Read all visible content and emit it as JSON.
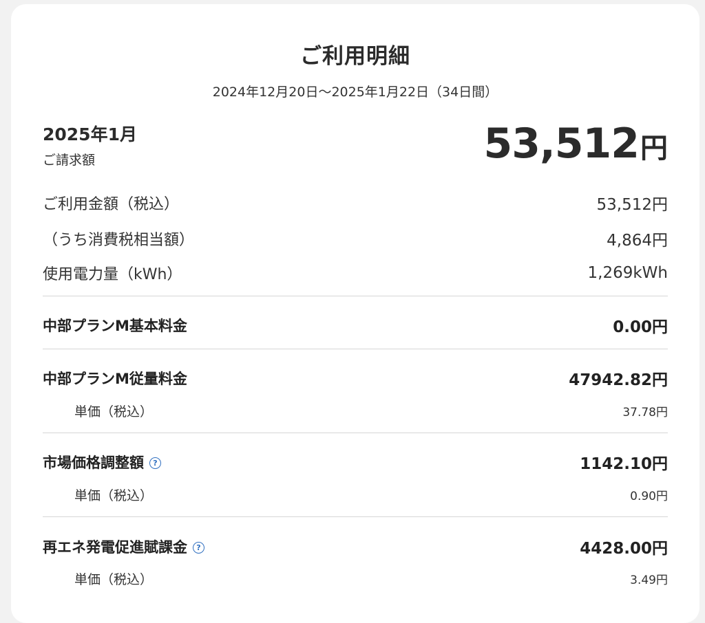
{
  "header": {
    "title": "ご利用明細",
    "period": "2024年12月20日〜2025年1月22日（34日間）"
  },
  "summary": {
    "month": "2025年1月",
    "billing_label": "ご請求額",
    "total_amount": "53,512",
    "total_unit": "円"
  },
  "overview": [
    {
      "label": "ご利用金額（税込）",
      "value": "53,512円"
    },
    {
      "label": "（うち消費税相当額）",
      "value": "4,864円"
    },
    {
      "label": "使用電力量（kWh）",
      "value": "1,269kWh"
    }
  ],
  "charges": {
    "basic": {
      "label": "中部プランM基本料金",
      "value": "0.00円"
    },
    "usage": {
      "label": "中部プランM従量料金",
      "value": "47942.82円",
      "unit_label": "単価（税込）",
      "unit_value": "37.78円"
    },
    "market": {
      "label": "市場価格調整額",
      "value": "1142.10円",
      "unit_label": "単価（税込）",
      "unit_value": "0.90円",
      "help_icon_glyph": "?"
    },
    "renewable": {
      "label": "再エネ発電促進賦課金",
      "value": "4428.00円",
      "unit_label": "単価（税込）",
      "unit_value": "3.49円",
      "help_icon_glyph": "?"
    }
  },
  "colors": {
    "accent_help": "#2f6fc0",
    "text": "#2b2b2b",
    "divider": "#d6d6d6"
  },
  "icons": [
    "help-circle-icon"
  ]
}
